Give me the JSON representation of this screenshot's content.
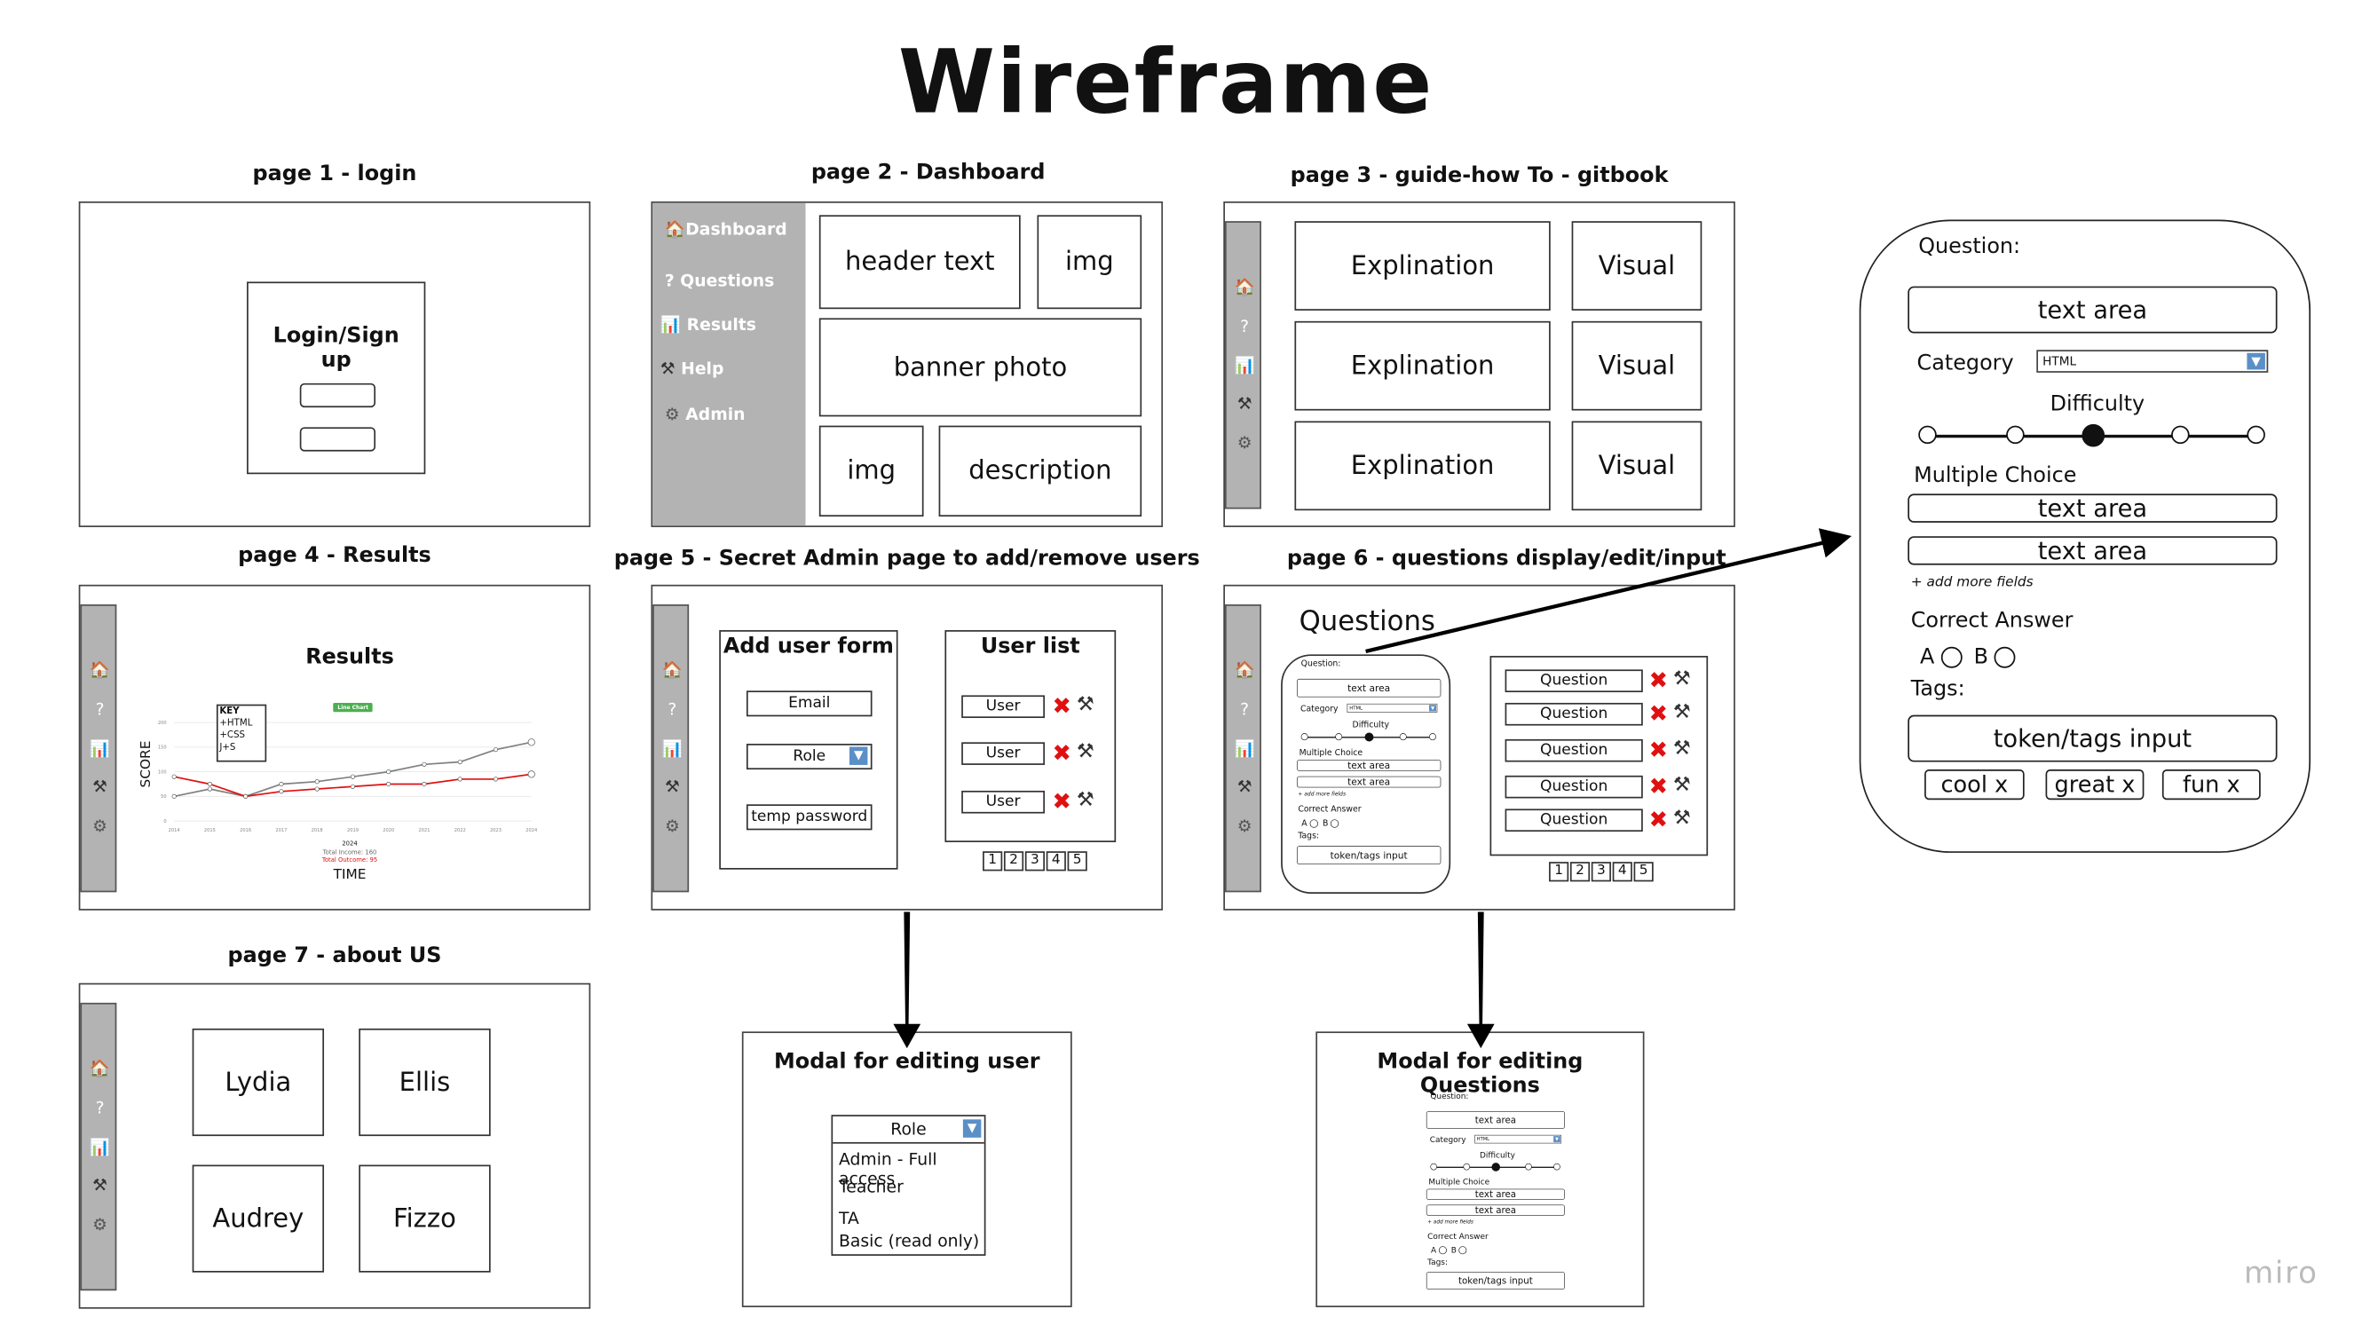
{
  "title": "Wireframe",
  "sidebar_icons": [
    "home-icon",
    "question-icon",
    "chart-icon",
    "tools-icon",
    "gear-icon"
  ],
  "sidebar_glyphs": {
    "home": "🏠",
    "question": "?",
    "chart": "📊",
    "tools": "⚒",
    "gear": "⚙"
  },
  "page1": {
    "label": "page 1 - login",
    "login_text": "Login/Sign up"
  },
  "page2": {
    "label": "page 2 - Dashboard",
    "nav": [
      "Dashboard",
      "Questions",
      "Results",
      "Help",
      "Admin"
    ],
    "header_text": "header text",
    "img1": "img",
    "banner": "banner photo",
    "img2": "img",
    "description": "description"
  },
  "page3": {
    "label": "page 3 - guide-how To - gitbook",
    "rows": [
      {
        "left": "Explination",
        "right": "Visual"
      },
      {
        "left": "Explination",
        "right": "Visual"
      },
      {
        "left": "Explination",
        "right": "Visual"
      }
    ]
  },
  "page4": {
    "label": "page 4 - Results"
  },
  "chart_data": {
    "type": "line",
    "title": "Results",
    "badge": "Line Chart",
    "xlabel": "TIME",
    "ylabel": "SCORE",
    "x": [
      2014,
      2015,
      2016,
      2017,
      2018,
      2019,
      2020,
      2021,
      2022,
      2023,
      2024
    ],
    "ylim": [
      0,
      200
    ],
    "yticks": [
      0,
      50,
      100,
      150,
      200
    ],
    "grid": true,
    "legend": {
      "title": "KEY",
      "entries": [
        "+HTML",
        "+CSS",
        "J+S"
      ],
      "placement": "top-left"
    },
    "series": [
      {
        "color": "#808080",
        "values": [
          50,
          65,
          50,
          75,
          80,
          90,
          100,
          115,
          120,
          145,
          160
        ]
      },
      {
        "color": "#e01010",
        "values": [
          90,
          75,
          50,
          60,
          65,
          70,
          75,
          75,
          85,
          85,
          95
        ]
      }
    ],
    "summary": {
      "year": "2024",
      "income": "Total Income: 160",
      "outcome": "Total Outcome: 95"
    }
  },
  "page5": {
    "label": "page 5 - Secret Admin page to add/remove users",
    "form_title": "Add user form",
    "email": "Email",
    "role": "Role",
    "temp_password": "temp password",
    "list_title": "User list",
    "users": [
      "User",
      "User",
      "User"
    ],
    "pages": [
      "1",
      "2",
      "3",
      "4",
      "5"
    ]
  },
  "page6": {
    "label": "page 6 - questions display/edit/input",
    "heading": "Questions",
    "questions": [
      "Question",
      "Question",
      "Question",
      "Question",
      "Question"
    ],
    "pages": [
      "1",
      "2",
      "3",
      "4",
      "5"
    ]
  },
  "page7": {
    "label": "page 7 - about US",
    "people": [
      "Lydia",
      "Ellis",
      "Audrey",
      "Fizzo"
    ]
  },
  "modal_user": {
    "title": "Modal for editing user",
    "role": "Role",
    "options": [
      "Admin - Full access",
      "Teacher",
      "TA",
      "Basic (read only)"
    ]
  },
  "modal_questions": {
    "title": "Modal for editing Questions"
  },
  "question_form": {
    "question_label": "Question:",
    "text_area": "text area",
    "category_label": "Category",
    "category_value": "HTML",
    "difficulty_label": "Difficulty",
    "difficulty_level": 3,
    "difficulty_max": 5,
    "multiple_choice_label": "Multiple Choice",
    "choices": [
      "text area",
      "text area"
    ],
    "add_more": "+ add more fields",
    "correct_answer_label": "Correct Answer",
    "answer_a": "A",
    "answer_b": "B",
    "tags_label": "Tags:",
    "tags_input": "token/tags input",
    "tags": [
      "cool x",
      "great x",
      "fun x"
    ]
  },
  "brand": "miro"
}
